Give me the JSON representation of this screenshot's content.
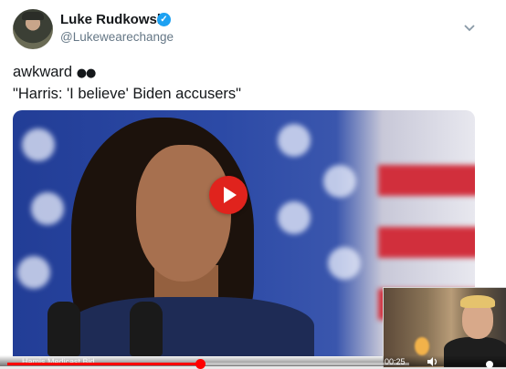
{
  "tweet": {
    "author_name": "Luke Rudkowski",
    "handle": "@Lukewearechange",
    "verified": true,
    "icons": {
      "verified": "verified-badge-icon",
      "menu": "chevron-down-icon",
      "eyes": "eyes-emoji-icon"
    },
    "text_line1": "awkward",
    "text_line2": "\"Harris: 'I believe' Biden accusers\""
  },
  "media": {
    "play_icon": "youtube-play-icon",
    "colors": {
      "play": "#e0231d",
      "flag_blue": "#2c4aa6",
      "flag_red": "#d12f3c"
    }
  },
  "video_player": {
    "title_fragment": "Hamis Medicast Bid",
    "time": "00:25",
    "progress": 0.48,
    "icons": {
      "volume": "volume-icon",
      "settings": "settings-icon"
    }
  },
  "colors": {
    "accent": "#1da1f2",
    "progress": "#ff0000",
    "handle": "#657786"
  }
}
